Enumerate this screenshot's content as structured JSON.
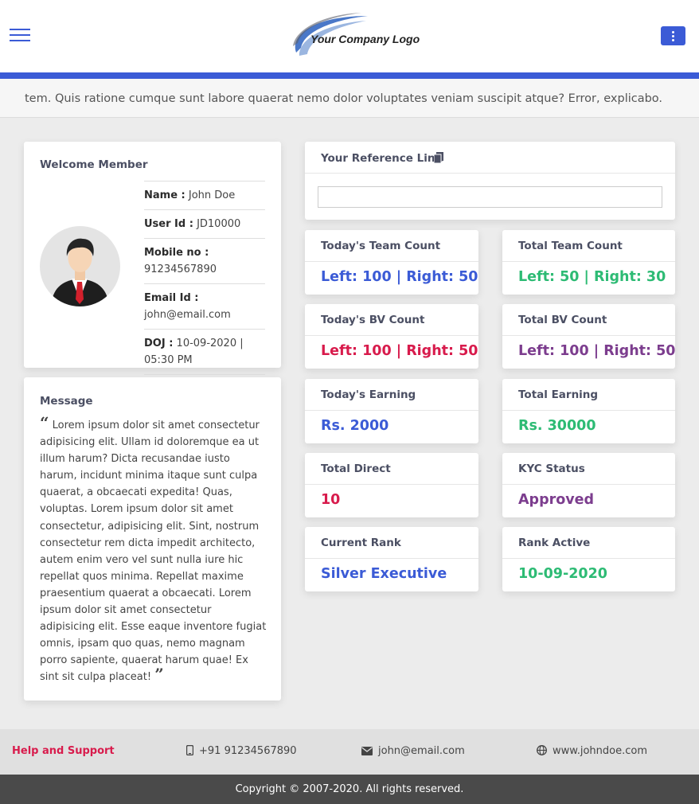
{
  "header": {
    "logo_text": "Your Company Logo",
    "accent_color": "#3b5bd6"
  },
  "ticker": {
    "text": "tem. Quis ratione cumque sunt labore quaerat nemo dolor voluptates veniam suscipit atque? Error, explicabo."
  },
  "welcome": {
    "title": "Welcome Member",
    "name_label": "Name :",
    "name": "John Doe",
    "userid_label": "User Id :",
    "userid": "JD10000",
    "mobile_label": "Mobile no :",
    "mobile": "91234567890",
    "email_label": "Email Id :",
    "email": "john@email.com",
    "doj_label": "DOJ :",
    "doj": "10-09-2020 | 05:30 PM"
  },
  "message": {
    "title": "Message",
    "body": "Lorem ipsum dolor sit amet consectetur adipisicing elit. Ullam id doloremque ea ut illum harum? Dicta recusandae iusto harum, incidunt minima itaque sunt culpa quaerat, a obcaecati expedita! Quas, voluptas. Lorem ipsum dolor sit amet consectetur, adipisicing elit. Sint, nostrum consectetur rem dicta impedit architecto, autem enim vero vel sunt nulla iure hic repellat quos minima. Repellat maxime praesentium quaerat a obcaecati. Lorem ipsum dolor sit amet consectetur adipisicing elit. Esse eaque inventore fugiat omnis, ipsam quo quas, nemo magnam porro sapiente, quaerat harum quae! Ex sint sit culpa placeat!"
  },
  "reference": {
    "title": "Your Reference Link",
    "value": ""
  },
  "stats": {
    "today_team": {
      "label": "Today's Team Count",
      "value": "Left: 100 | Right: 50",
      "color": "#3b5bd6"
    },
    "total_team": {
      "label": "Total Team Count",
      "value": "Left: 50 | Right: 30",
      "color": "#2dbb74"
    },
    "today_bv": {
      "label": "Today's BV Count",
      "value": "Left: 100 | Right: 50",
      "color": "#d81b4c"
    },
    "total_bv": {
      "label": "Total BV Count",
      "value": "Left: 100 | Right: 50",
      "color": "#7c3d8e"
    },
    "today_earning": {
      "label": "Today's Earning",
      "value": "Rs. 2000",
      "color": "#3b5bd6"
    },
    "total_earning": {
      "label": "Total Earning",
      "value": "Rs. 30000",
      "color": "#2dbb74"
    },
    "total_direct": {
      "label": "Total Direct",
      "value": "10",
      "color": "#d81b4c"
    },
    "kyc": {
      "label": "KYC Status",
      "value": "Approved",
      "color": "#7c3d8e"
    },
    "rank": {
      "label": "Current Rank",
      "value": "Silver Executive",
      "color": "#3b5bd6"
    },
    "rank_active": {
      "label": "Rank Active",
      "value": "10-09-2020",
      "color": "#2dbb74"
    }
  },
  "footer": {
    "help": "Help and Support",
    "phone": "+91 91234567890",
    "email": "john@email.com",
    "website": "www.johndoe.com",
    "copyright": "Copyright © 2007-2020. All rights reserved."
  }
}
